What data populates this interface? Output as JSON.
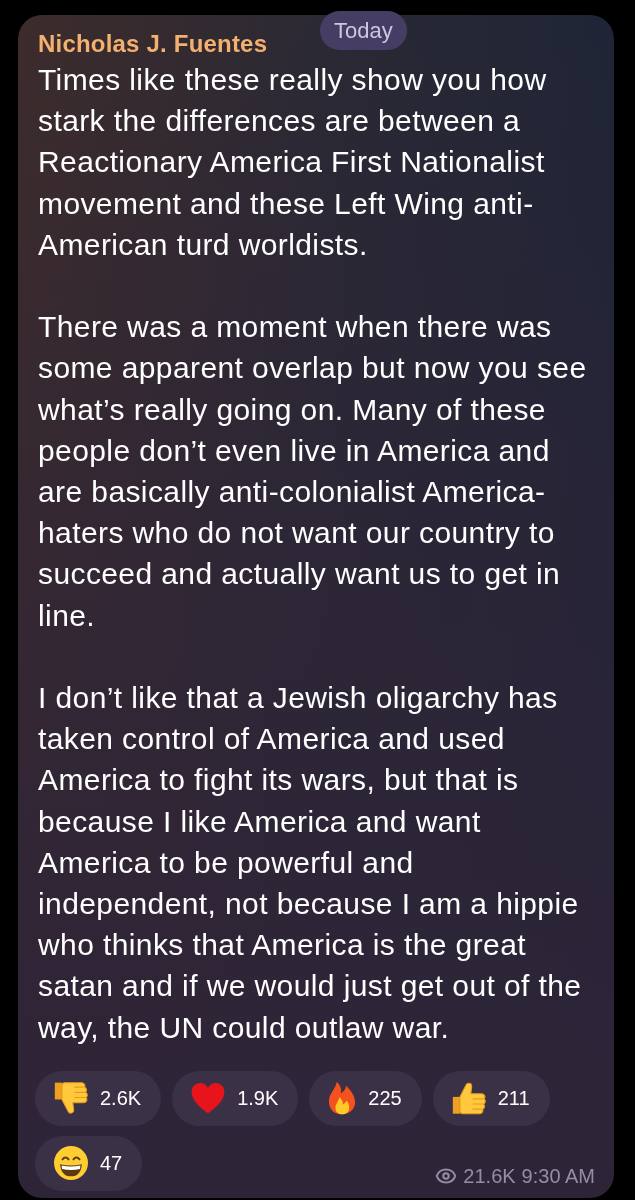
{
  "date_badge": {
    "label": "Today"
  },
  "message": {
    "sender": "Nicholas J. Fuentes",
    "paragraphs": [
      "Times like these really show you how stark the differences are between a Reactionary America First Nationalist movement and these Left Wing anti-American turd worldists.",
      "There was a moment when there was some apparent overlap but now you see what’s really going on. Many of these people don’t even live in America and are basically anti-colonialist America-haters who do not want our country to succeed and actually want us to get in line.",
      "I don’t like that a Jewish oligarchy has taken control of America and used America to fight its wars, but that is because I like America and want America to be powerful and independent, not because I am a hippie who thinks that America is the great satan and if we would just get out of the way, the UN could outlaw war."
    ],
    "reactions": [
      {
        "kind": "dislike",
        "count": "2.6K"
      },
      {
        "kind": "heart",
        "count": "1.9K"
      },
      {
        "kind": "fire",
        "count": "225"
      },
      {
        "kind": "like",
        "count": "211"
      },
      {
        "kind": "grin",
        "count": "47"
      }
    ],
    "views": "21.6K",
    "time": "9:30 AM"
  }
}
